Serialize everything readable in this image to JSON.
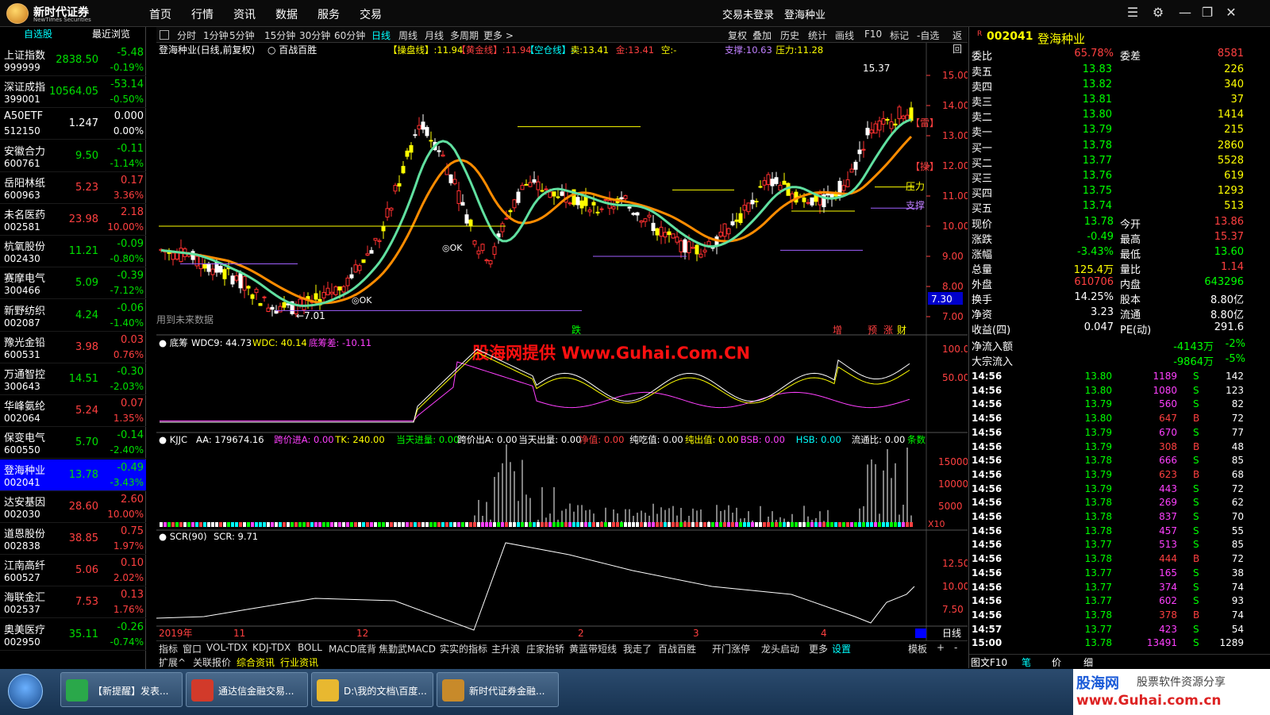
{
  "app": {
    "brand": "新时代证券",
    "brand_en": "NewTimes Securities",
    "login_status": "交易未登录",
    "current_stock_name": "登海种业"
  },
  "menu": [
    "首页",
    "行情",
    "资讯",
    "数据",
    "服务",
    "交易"
  ],
  "left": {
    "tabs": [
      "自选股",
      "最近浏览"
    ],
    "stocks": [
      {
        "name": "上证指数",
        "code": "999999",
        "price": "2838.50",
        "change": "-5.48",
        "pct": "-0.19%",
        "dir": "dn"
      },
      {
        "name": "深证成指",
        "code": "399001",
        "price": "10564.05",
        "change": "-53.14",
        "pct": "-0.50%",
        "dir": "dn"
      },
      {
        "name": "A50ETF",
        "code": "512150",
        "price": "1.247",
        "change": "0.000",
        "pct": "0.00%",
        "dir": "fl"
      },
      {
        "name": "安徽合力",
        "code": "600761",
        "price": "9.50",
        "change": "-0.11",
        "pct": "-1.14%",
        "dir": "dn"
      },
      {
        "name": "岳阳林纸",
        "code": "600963",
        "price": "5.23",
        "change": "0.17",
        "pct": "3.36%",
        "dir": "up"
      },
      {
        "name": "未名医药",
        "code": "002581",
        "price": "23.98",
        "change": "2.18",
        "pct": "10.00%",
        "dir": "up"
      },
      {
        "name": "杭氧股份",
        "code": "002430",
        "price": "11.21",
        "change": "-0.09",
        "pct": "-0.80%",
        "dir": "dn"
      },
      {
        "name": "赛摩电气",
        "code": "300466",
        "price": "5.09",
        "change": "-0.39",
        "pct": "-7.12%",
        "dir": "dn"
      },
      {
        "name": "新野纺织",
        "code": "002087",
        "price": "4.24",
        "change": "-0.06",
        "pct": "-1.40%",
        "dir": "dn"
      },
      {
        "name": "豫光金铅",
        "code": "600531",
        "price": "3.98",
        "change": "0.03",
        "pct": "0.76%",
        "dir": "up"
      },
      {
        "name": "万通智控",
        "code": "300643",
        "price": "14.51",
        "change": "-0.30",
        "pct": "-2.03%",
        "dir": "dn"
      },
      {
        "name": "华峰氨纶",
        "code": "002064",
        "price": "5.24",
        "change": "0.07",
        "pct": "1.35%",
        "dir": "up"
      },
      {
        "name": "保变电气",
        "code": "600550",
        "price": "5.70",
        "change": "-0.14",
        "pct": "-2.40%",
        "dir": "dn"
      },
      {
        "name": "登海种业",
        "code": "002041",
        "price": "13.78",
        "change": "-0.49",
        "pct": "-3.43%",
        "dir": "dn",
        "selected": true
      },
      {
        "name": "达安基因",
        "code": "002030",
        "price": "28.60",
        "change": "2.60",
        "pct": "10.00%",
        "dir": "up"
      },
      {
        "name": "道恩股份",
        "code": "002838",
        "price": "38.85",
        "change": "0.75",
        "pct": "1.97%",
        "dir": "up"
      },
      {
        "name": "江南高纤",
        "code": "600527",
        "price": "5.06",
        "change": "0.10",
        "pct": "2.02%",
        "dir": "up"
      },
      {
        "name": "海联金汇",
        "code": "002537",
        "price": "7.53",
        "change": "0.13",
        "pct": "1.76%",
        "dir": "up"
      },
      {
        "name": "奥美医疗",
        "code": "002950",
        "price": "35.11",
        "change": "-0.26",
        "pct": "-0.74%",
        "dir": "dn"
      }
    ]
  },
  "periods": [
    "分时",
    "1分钟",
    "5分钟",
    "15分钟",
    "30分钟",
    "60分钟",
    "日线",
    "周线",
    "月线",
    "多周期",
    "更多 >"
  ],
  "tools": [
    "复权",
    "叠加",
    "历史",
    "统计",
    "画线",
    "F10",
    "标记",
    "-自选",
    "返回"
  ],
  "main": {
    "title": "登海种业(日线,前复权)",
    "formula": "百战百胜",
    "legend": [
      {
        "t": "【操盘线】:11.94",
        "c": "#ffff00"
      },
      {
        "t": "【黄金线】:11.94",
        "c": "#ff4040"
      },
      {
        "t": "【空仓线】:-",
        "c": "#00ffff"
      },
      {
        "t": "卖:13.41",
        "c": "#ffff00"
      },
      {
        "t": "金:13.41",
        "c": "#ff4040"
      },
      {
        "t": "空:-",
        "c": "#ffff00"
      },
      {
        "t": "支撑:10.63",
        "c": "#c080ff"
      },
      {
        "t": "压力:11.28",
        "c": "#ffff00"
      }
    ],
    "yticks": [
      "15.00",
      "14.00",
      "13.00",
      "12.00",
      "11.00",
      "10.00",
      "9.00",
      "8.00",
      "7.00"
    ],
    "price_tag": "7.30",
    "high_label": "15.37",
    "low_label": "7.01",
    "note": "用到未来数据",
    "ok_label": "OK",
    "side_labels": [
      "【雷】",
      "【操】",
      "压力",
      "支撑"
    ],
    "event_labels": [
      {
        "t": "跌",
        "c": "#00ff00"
      },
      {
        "t": "增",
        "c": "#ff4040"
      },
      {
        "t": "预",
        "c": "#ff4040"
      },
      {
        "t": "涨",
        "c": "#ff4040"
      },
      {
        "t": "财",
        "c": "#ffff00"
      }
    ]
  },
  "sub1": {
    "name": "底筹",
    "v1": "WDC9: 44.73",
    "v2": "WDC: 40.14",
    "v3": "底筹差: -10.11",
    "yticks": [
      "100.0",
      "50.00"
    ],
    "watermark": "股海网提供 Www.Guhai.Com.CN"
  },
  "sub2": {
    "name": "KJJC",
    "items": [
      {
        "t": "AA: 179674.16",
        "c": "#fff"
      },
      {
        "t": "跨价进A: 0.00",
        "c": "#ff40ff"
      },
      {
        "t": "TK: 240.00",
        "c": "#ffff00"
      },
      {
        "t": "当天进量: 0.00",
        "c": "#00ff00"
      },
      {
        "t": "跨价出A: 0.00",
        "c": "#fff"
      },
      {
        "t": "当天出量: 0.00",
        "c": "#fff"
      },
      {
        "t": "净值: 0.00",
        "c": "#ff4040"
      },
      {
        "t": "纯吃值: 0.00",
        "c": "#fff"
      },
      {
        "t": "纯出值: 0.00",
        "c": "#ffff00"
      },
      {
        "t": "BSB: 0.00",
        "c": "#ff40ff"
      },
      {
        "t": "HSB: 0.00",
        "c": "#00ffff"
      },
      {
        "t": "流通比: 0.00",
        "c": "#fff"
      },
      {
        "t": "条数",
        "c": "#00ff00"
      }
    ],
    "yticks": [
      "15000",
      "10000",
      "5000"
    ],
    "scale": "X10"
  },
  "sub3": {
    "name": "SCR(90)",
    "v": "SCR: 9.71",
    "yticks": [
      "12.50",
      "10.00",
      "7.50"
    ]
  },
  "xaxis": [
    "2019年",
    "11",
    "12",
    "2",
    "3",
    "4"
  ],
  "xaxis_right": "日线",
  "bottom_tabs": [
    "指标",
    "窗口",
    "VOL-TDX",
    "KDJ-TDX",
    "BOLL",
    "MACD底背",
    "焦勤武MACD",
    "实实的指标",
    "主升浪",
    "庄家抬轿",
    "黄蓝带短线",
    "我走了",
    "百战百胜",
    "开门涨停",
    "龙头启动",
    "更多",
    "设置",
    "模板",
    "+",
    "-"
  ],
  "bottom_tabs2": [
    "扩展^",
    "关联报价",
    "综合资讯",
    "行业资讯"
  ],
  "right": {
    "code": "002041",
    "name": "登海种业",
    "wei": {
      "bi_label": "委比",
      "bi": "65.78%",
      "cha_label": "委差",
      "cha": "8581"
    },
    "sells": [
      {
        "l": "卖五",
        "p": "13.83",
        "v": "226"
      },
      {
        "l": "卖四",
        "p": "13.82",
        "v": "340"
      },
      {
        "l": "卖三",
        "p": "13.81",
        "v": "37"
      },
      {
        "l": "卖二",
        "p": "13.80",
        "v": "1414"
      },
      {
        "l": "卖一",
        "p": "13.79",
        "v": "215"
      }
    ],
    "buys": [
      {
        "l": "买一",
        "p": "13.78",
        "v": "2860"
      },
      {
        "l": "买二",
        "p": "13.77",
        "v": "5528"
      },
      {
        "l": "买三",
        "p": "13.76",
        "v": "619"
      },
      {
        "l": "买四",
        "p": "13.75",
        "v": "1293"
      },
      {
        "l": "买五",
        "p": "13.74",
        "v": "513"
      }
    ],
    "quote": [
      {
        "l1": "现价",
        "v1": "13.78",
        "c1": "#00ff00",
        "l2": "今开",
        "v2": "13.86",
        "c2": "#ff4040"
      },
      {
        "l1": "涨跌",
        "v1": "-0.49",
        "c1": "#00ff00",
        "l2": "最高",
        "v2": "15.37",
        "c2": "#ff4040"
      },
      {
        "l1": "涨幅",
        "v1": "-3.43%",
        "c1": "#00ff00",
        "l2": "最低",
        "v2": "13.60",
        "c2": "#00ff00"
      },
      {
        "l1": "总量",
        "v1": "125.4万",
        "c1": "#ffff00",
        "l2": "量比",
        "v2": "1.14",
        "c2": "#ff4040"
      },
      {
        "l1": "外盘",
        "v1": "610706",
        "c1": "#ff4040",
        "l2": "内盘",
        "v2": "643296",
        "c2": "#00ff00"
      },
      {
        "l1": "换手",
        "v1": "14.25%",
        "c1": "#fff",
        "l2": "股本",
        "v2": "8.80亿",
        "c2": "#fff"
      },
      {
        "l1": "净资",
        "v1": "3.23",
        "c1": "#fff",
        "l2": "流通",
        "v2": "8.80亿",
        "c2": "#fff"
      },
      {
        "l1": "收益(四)",
        "v1": "0.047",
        "c1": "#fff",
        "l2": "PE(动)",
        "v2": "291.6",
        "c2": "#fff"
      }
    ],
    "flow": [
      {
        "l": "净流入额",
        "v": "-4143万",
        "p": "-2%"
      },
      {
        "l": "大宗流入",
        "v": "-9864万",
        "p": "-5%"
      }
    ],
    "ticks": [
      [
        "14:56",
        "13.80",
        "1189",
        "S",
        "142"
      ],
      [
        "14:56",
        "13.80",
        "1080",
        "S",
        "123"
      ],
      [
        "14:56",
        "13.79",
        "560",
        "S",
        "82"
      ],
      [
        "14:56",
        "13.80",
        "647",
        "B",
        "72"
      ],
      [
        "14:56",
        "13.79",
        "670",
        "S",
        "77"
      ],
      [
        "14:56",
        "13.79",
        "308",
        "B",
        "48"
      ],
      [
        "14:56",
        "13.78",
        "666",
        "S",
        "85"
      ],
      [
        "14:56",
        "13.79",
        "623",
        "B",
        "68"
      ],
      [
        "14:56",
        "13.79",
        "443",
        "S",
        "72"
      ],
      [
        "14:56",
        "13.78",
        "269",
        "S",
        "62"
      ],
      [
        "14:56",
        "13.78",
        "837",
        "S",
        "70"
      ],
      [
        "14:56",
        "13.78",
        "457",
        "S",
        "55"
      ],
      [
        "14:56",
        "13.77",
        "513",
        "S",
        "85"
      ],
      [
        "14:56",
        "13.78",
        "444",
        "B",
        "72"
      ],
      [
        "14:56",
        "13.77",
        "165",
        "S",
        "38"
      ],
      [
        "14:56",
        "13.77",
        "374",
        "S",
        "74"
      ],
      [
        "14:56",
        "13.77",
        "602",
        "S",
        "93"
      ],
      [
        "14:56",
        "13.78",
        "378",
        "B",
        "74"
      ],
      [
        "14:57",
        "13.77",
        "423",
        "S",
        "54"
      ],
      [
        "15:00",
        "13.78",
        "13491",
        "S",
        "1289"
      ]
    ],
    "bottom": [
      "图文F10",
      "笔",
      "价",
      "细"
    ]
  },
  "taskbar": [
    {
      "t": "【新提醒】发表...",
      "c": "#2aa84a"
    },
    {
      "t": "通达信金融交易...",
      "c": "#d23a2a"
    },
    {
      "t": "D:\\我的文档\\百度...",
      "c": "#e8b830"
    },
    {
      "t": "新时代证券金融...",
      "c": "#c88a2a"
    }
  ],
  "watermark_br": {
    "t1": "股海网",
    "t2": "股票软件资源分享",
    "t3": "www.Guhai.com.cn"
  },
  "colors": {
    "up": "#ff4040",
    "down": "#00e000",
    "panel": "#000000",
    "selected": "#0000ff"
  }
}
